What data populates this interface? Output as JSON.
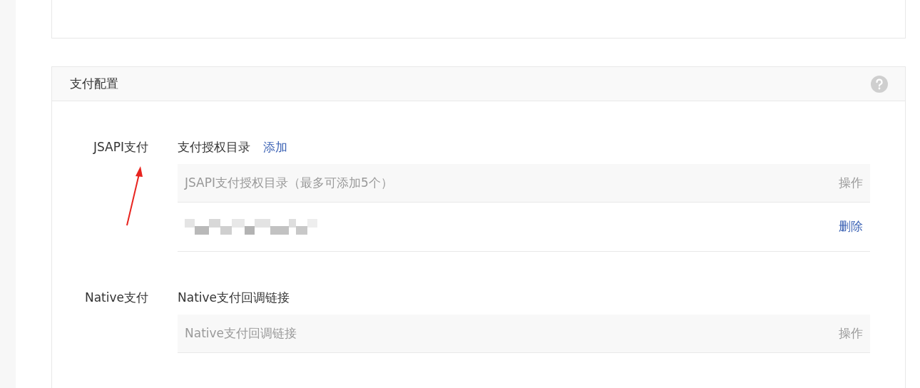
{
  "panel": {
    "title": "支付配置"
  },
  "sections": [
    {
      "label": "JSAPI支付",
      "title": "支付授权目录",
      "action": "添加",
      "table": {
        "columns": [
          "JSAPI支付授权目录（最多可添加5个）",
          "操作"
        ],
        "rows": [
          {
            "value": {
              "kind": "redacted"
            },
            "action": "删除"
          }
        ]
      }
    },
    {
      "label": "Native支付",
      "title": "Native支付回调链接",
      "table": {
        "columns": [
          "Native支付回调链接",
          "操作"
        ]
      }
    }
  ],
  "annotation": {
    "kind": "arrow"
  }
}
